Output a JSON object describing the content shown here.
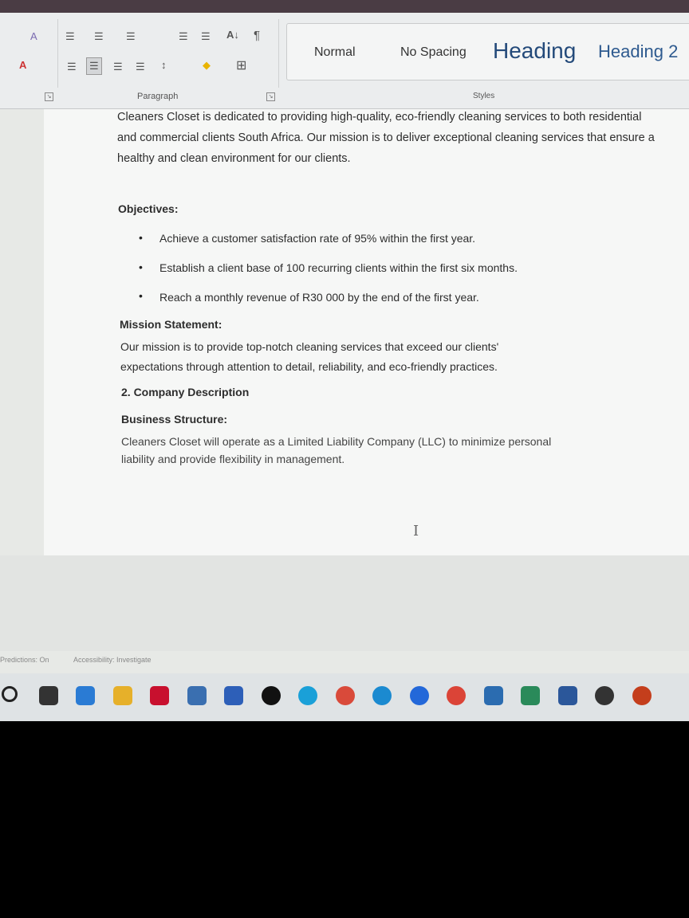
{
  "ribbon": {
    "groups": {
      "paragraph": "Paragraph",
      "styles": "Styles"
    },
    "styles": [
      "Normal",
      "No Spacing",
      "Heading",
      "Heading 2"
    ],
    "tools": {
      "bullets": "☰",
      "numbering": "☰",
      "multilevel": "☰",
      "decrease_indent": "☰",
      "increase_indent": "☰",
      "sort": "A↓",
      "pilcrow": "¶",
      "align_left": "☰",
      "align_center": "☰",
      "align_right": "☰",
      "justify": "☰",
      "line_spacing": "↕",
      "shading": "◆",
      "borders": "⊞",
      "font_color": "A",
      "text_effects": "A"
    }
  },
  "document": {
    "intro": "Cleaners Closet is dedicated to providing high-quality, eco-friendly cleaning services to both residential and commercial clients South Africa. Our mission is to deliver exceptional cleaning services that ensure a healthy and clean environment for our clients.",
    "objectives_heading": "Objectives:",
    "objectives": [
      "Achieve a customer satisfaction rate of 95% within the first year.",
      "Establish a client base of 100 recurring clients within the first six months.",
      "Reach a monthly revenue of R30 000 by the end of the first year."
    ],
    "mission_heading": "Mission Statement:",
    "mission_line1": "Our mission is to provide top-notch cleaning services that exceed our clients'",
    "mission_line2": "expectations through attention to detail, reliability, and eco-friendly practices.",
    "section2_heading": "2. Company Description",
    "structure_heading": "Business Structure:",
    "structure_line1": "Cleaners Closet will operate as a Limited Liability Company (LLC) to minimize personal",
    "structure_line2": "liability and provide flexibility in management.",
    "cursor": "I"
  },
  "status": {
    "predictions": "Predictions: On",
    "accessibility": "Accessibility: Investigate"
  },
  "taskbar": {
    "icons": [
      "search-icon",
      "task-view-icon",
      "widgets-icon",
      "file-explorer-icon",
      "mcafee-icon",
      "store-icon",
      "lightroom-icon",
      "tiktok-icon",
      "edge-icon",
      "chrome-icon",
      "photos-icon",
      "messenger-icon",
      "chrome-alt-icon",
      "mail-icon",
      "word-doc-icon",
      "word-icon",
      "media-player-icon",
      "powerpoint-icon"
    ],
    "colors": [
      "#222",
      "#333",
      "#2a7bd4",
      "#e6b02a",
      "#c8102e",
      "#3a6fb0",
      "#2d5fb8",
      "#111",
      "#1aa0d8",
      "#d94a3a",
      "#1b8ad0",
      "#2368d9",
      "#db4437",
      "#2b6cb0",
      "#2a8a5a",
      "#2b579a",
      "#333",
      "#c43e1c"
    ]
  },
  "colors": {
    "accent": "#2b579a",
    "document_bg": "#f6f7f6",
    "ribbon_bg": "#ebedee"
  }
}
